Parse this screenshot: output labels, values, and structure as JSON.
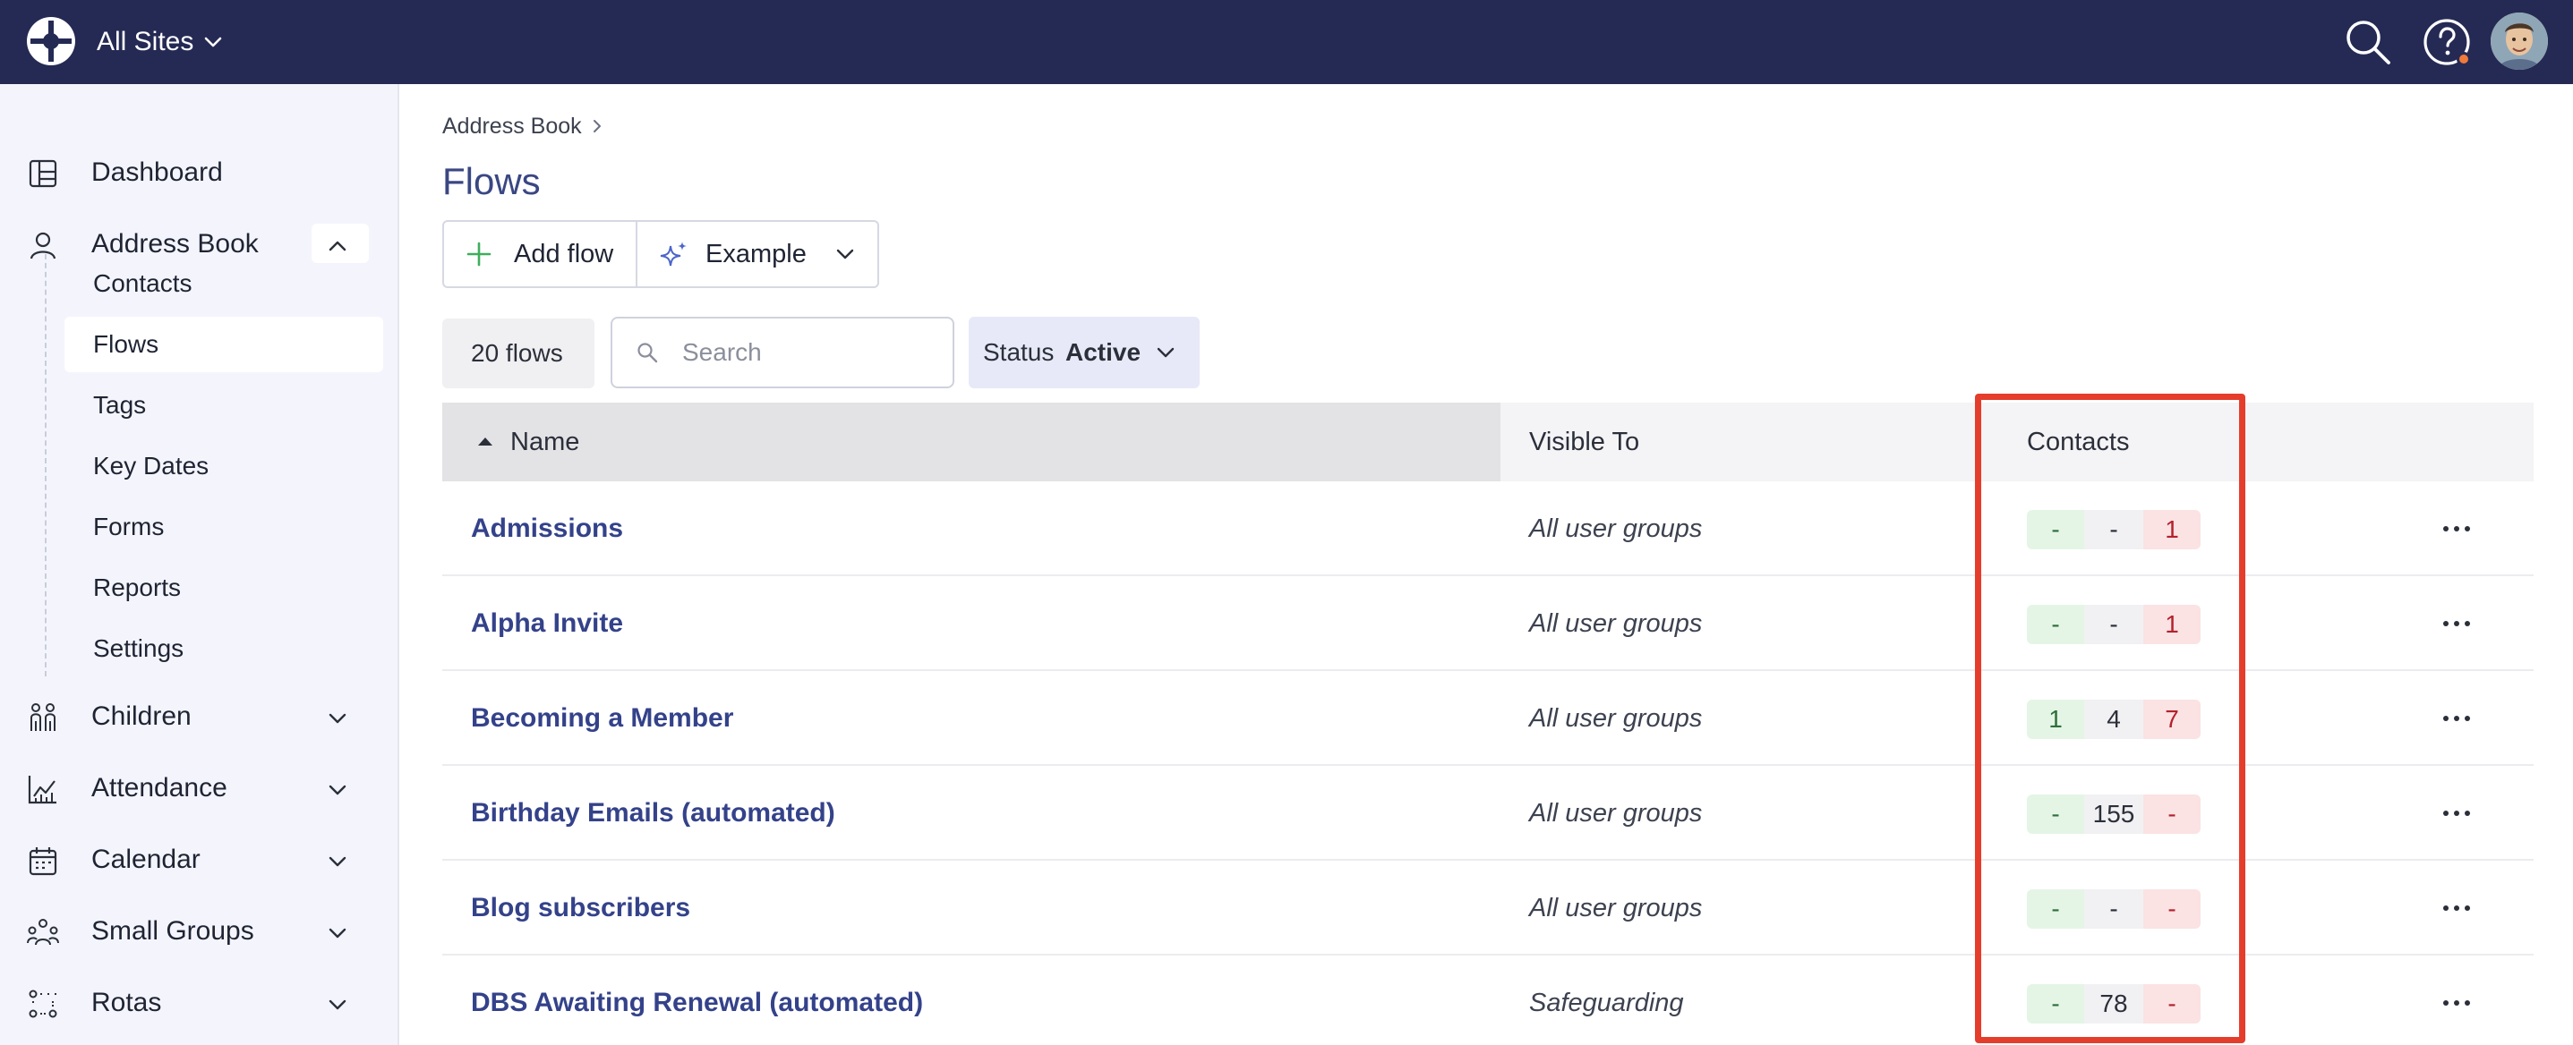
{
  "topbar": {
    "site_label": "All Sites",
    "colors": {
      "bar": "#252a54",
      "notification_dot": "#f07a3a"
    }
  },
  "sidebar": {
    "items": [
      {
        "label": "Dashboard",
        "icon": "dashboard-icon"
      },
      {
        "label": "Address Book",
        "icon": "person-icon",
        "expanded": true
      },
      {
        "label": "Children",
        "icon": "children-icon"
      },
      {
        "label": "Attendance",
        "icon": "chart-icon"
      },
      {
        "label": "Calendar",
        "icon": "calendar-icon"
      },
      {
        "label": "Small Groups",
        "icon": "group-icon"
      },
      {
        "label": "Rotas",
        "icon": "rota-icon"
      }
    ],
    "subitems": [
      "Contacts",
      "Flows",
      "Tags",
      "Key Dates",
      "Forms",
      "Reports",
      "Settings"
    ],
    "active_subitem": "Flows"
  },
  "breadcrumb": {
    "parent": "Address Book"
  },
  "page": {
    "title": "Flows"
  },
  "toolbar": {
    "add_label": "Add flow",
    "example_label": "Example"
  },
  "filters": {
    "count_label": "20 flows",
    "search_placeholder": "Search",
    "status_key": "Status",
    "status_value": "Active"
  },
  "table": {
    "headers": {
      "name": "Name",
      "visible_to": "Visible To",
      "contacts": "Contacts"
    },
    "rows": [
      {
        "name": "Admissions",
        "visible_to": "All user groups",
        "contacts": [
          "-",
          "-",
          "1"
        ]
      },
      {
        "name": "Alpha Invite",
        "visible_to": "All user groups",
        "contacts": [
          "-",
          "-",
          "1"
        ]
      },
      {
        "name": "Becoming a Member",
        "visible_to": "All user groups",
        "contacts": [
          "1",
          "4",
          "7"
        ]
      },
      {
        "name": "Birthday Emails (automated)",
        "visible_to": "All user groups",
        "contacts": [
          "-",
          "155",
          "-"
        ]
      },
      {
        "name": "Blog subscribers",
        "visible_to": "All user groups",
        "contacts": [
          "-",
          "-",
          "-"
        ]
      },
      {
        "name": "DBS Awaiting Renewal (automated)",
        "visible_to": "Safeguarding",
        "contacts": [
          "-",
          "78",
          "-"
        ]
      }
    ]
  },
  "colors": {
    "link": "#34428a",
    "title": "#3a4783",
    "highlight_border": "#e53d2c",
    "green_cell": "#e4f5e6",
    "red_cell": "#fbe2e3"
  }
}
